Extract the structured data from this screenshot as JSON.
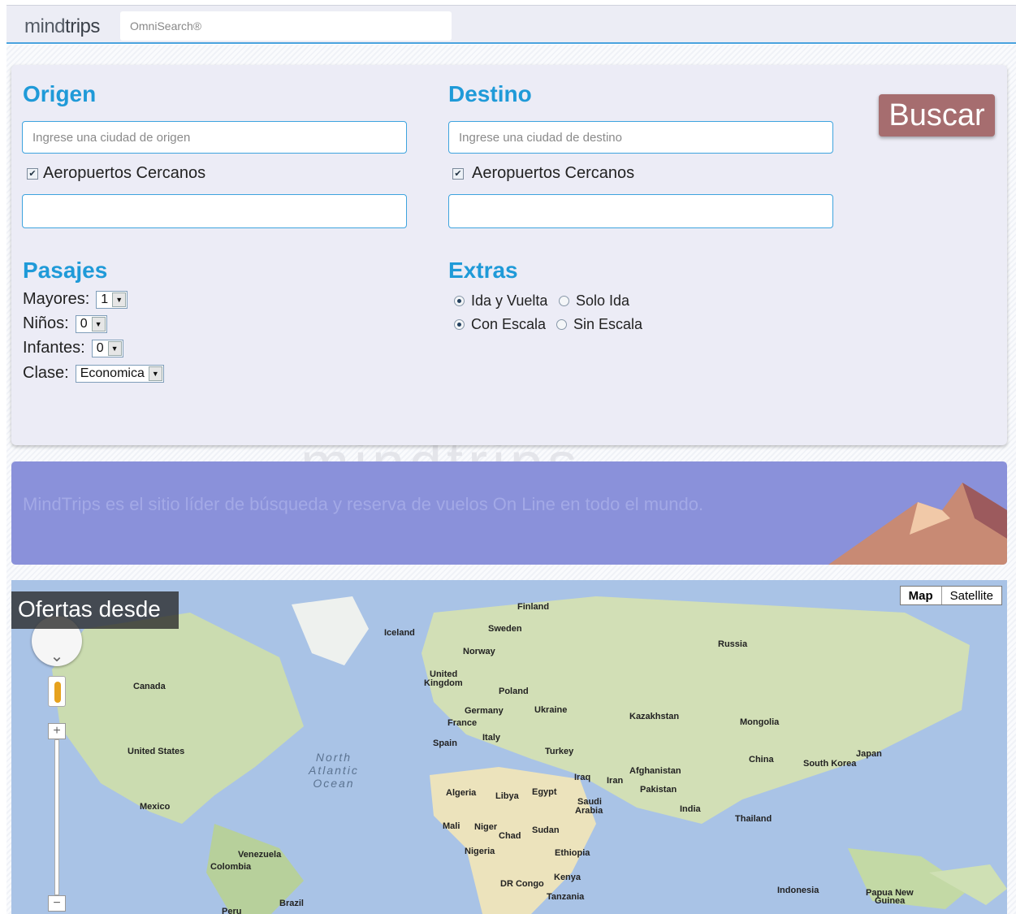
{
  "header": {
    "logo_light": "mind",
    "logo_bold": "trips",
    "omnisearch_placeholder": "OmniSearch®"
  },
  "search": {
    "origin": {
      "heading": "Origen",
      "placeholder": "Ingrese una ciudad de origen",
      "nearby_label": "Aeropuertos Cercanos",
      "nearby_checked": true
    },
    "destination": {
      "heading": "Destino",
      "placeholder": "Ingrese una ciudad de destino",
      "nearby_label": "Aeropuertos Cercanos",
      "nearby_checked": true
    },
    "search_button": "Buscar",
    "passengers": {
      "heading": "Pasajes",
      "adults_label": "Mayores:",
      "adults_value": "1",
      "children_label": "Niños:",
      "children_value": "0",
      "infants_label": "Infantes:",
      "infants_value": "0",
      "class_label": "Clase:",
      "class_value": "Economica"
    },
    "extras": {
      "heading": "Extras",
      "round_trip": "Ida y Vuelta",
      "one_way": "Solo Ida",
      "with_stops": "Con Escala",
      "nonstop": "Sin Escala"
    }
  },
  "banner": {
    "message": "MindTrips es el sitio líder de búsqueda y reserva de vuelos On Line en todo el mundo."
  },
  "map": {
    "offers_title": "Ofertas desde",
    "type_map": "Map",
    "type_satellite": "Satellite",
    "ocean_label_line1": "North",
    "ocean_label_line2": "Atlantic",
    "ocean_label_line3": "Ocean",
    "countries": {
      "finland": "Finland",
      "iceland": "Iceland",
      "sweden": "Sweden",
      "norway": "Norway",
      "russia": "Russia",
      "uk1": "United",
      "uk2": "Kingdom",
      "poland": "Poland",
      "canada": "Canada",
      "germany": "Germany",
      "ukraine": "Ukraine",
      "france": "France",
      "kazakhstan": "Kazakhstan",
      "mongolia": "Mongolia",
      "italy": "Italy",
      "spain": "Spain",
      "usa": "United States",
      "turkey": "Turkey",
      "china": "China",
      "japan": "Japan",
      "south_korea": "South Korea",
      "afghanistan": "Afghanistan",
      "iraq": "Iraq",
      "iran": "Iran",
      "pakistan": "Pakistan",
      "algeria": "Algeria",
      "libya": "Libya",
      "egypt": "Egypt",
      "saudi1": "Saudi",
      "saudi2": "Arabia",
      "india": "India",
      "mexico": "Mexico",
      "thailand": "Thailand",
      "mali": "Mali",
      "niger": "Niger",
      "chad": "Chad",
      "sudan": "Sudan",
      "nigeria": "Nigeria",
      "ethiopia": "Ethiopia",
      "venezuela": "Venezuela",
      "colombia": "Colombia",
      "kenya": "Kenya",
      "drcongo": "DR Congo",
      "tanzania": "Tanzania",
      "indonesia": "Indonesia",
      "png1": "Papua New",
      "png2": "Guinea",
      "brazil": "Brazil",
      "peru": "Peru"
    }
  },
  "colors": {
    "accent": "#1f9ad8",
    "button": "#a66d6f",
    "banner": "#8a91da"
  }
}
